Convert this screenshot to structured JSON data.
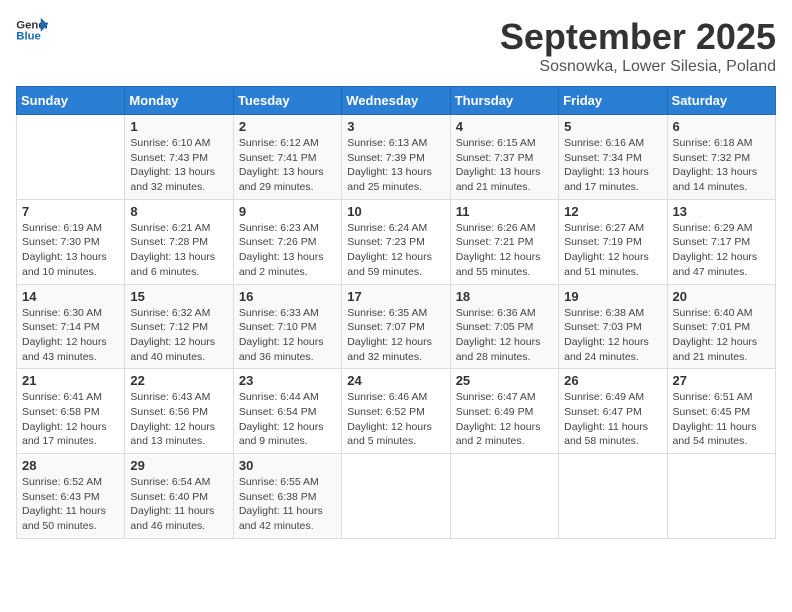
{
  "logo": {
    "text_general": "General",
    "text_blue": "Blue"
  },
  "header": {
    "month": "September 2025",
    "location": "Sosnowka, Lower Silesia, Poland"
  },
  "weekdays": [
    "Sunday",
    "Monday",
    "Tuesday",
    "Wednesday",
    "Thursday",
    "Friday",
    "Saturday"
  ],
  "weeks": [
    [
      {
        "day": "",
        "sunrise": "",
        "sunset": "",
        "daylight": ""
      },
      {
        "day": "1",
        "sunrise": "Sunrise: 6:10 AM",
        "sunset": "Sunset: 7:43 PM",
        "daylight": "Daylight: 13 hours and 32 minutes."
      },
      {
        "day": "2",
        "sunrise": "Sunrise: 6:12 AM",
        "sunset": "Sunset: 7:41 PM",
        "daylight": "Daylight: 13 hours and 29 minutes."
      },
      {
        "day": "3",
        "sunrise": "Sunrise: 6:13 AM",
        "sunset": "Sunset: 7:39 PM",
        "daylight": "Daylight: 13 hours and 25 minutes."
      },
      {
        "day": "4",
        "sunrise": "Sunrise: 6:15 AM",
        "sunset": "Sunset: 7:37 PM",
        "daylight": "Daylight: 13 hours and 21 minutes."
      },
      {
        "day": "5",
        "sunrise": "Sunrise: 6:16 AM",
        "sunset": "Sunset: 7:34 PM",
        "daylight": "Daylight: 13 hours and 17 minutes."
      },
      {
        "day": "6",
        "sunrise": "Sunrise: 6:18 AM",
        "sunset": "Sunset: 7:32 PM",
        "daylight": "Daylight: 13 hours and 14 minutes."
      }
    ],
    [
      {
        "day": "7",
        "sunrise": "Sunrise: 6:19 AM",
        "sunset": "Sunset: 7:30 PM",
        "daylight": "Daylight: 13 hours and 10 minutes."
      },
      {
        "day": "8",
        "sunrise": "Sunrise: 6:21 AM",
        "sunset": "Sunset: 7:28 PM",
        "daylight": "Daylight: 13 hours and 6 minutes."
      },
      {
        "day": "9",
        "sunrise": "Sunrise: 6:23 AM",
        "sunset": "Sunset: 7:26 PM",
        "daylight": "Daylight: 13 hours and 2 minutes."
      },
      {
        "day": "10",
        "sunrise": "Sunrise: 6:24 AM",
        "sunset": "Sunset: 7:23 PM",
        "daylight": "Daylight: 12 hours and 59 minutes."
      },
      {
        "day": "11",
        "sunrise": "Sunrise: 6:26 AM",
        "sunset": "Sunset: 7:21 PM",
        "daylight": "Daylight: 12 hours and 55 minutes."
      },
      {
        "day": "12",
        "sunrise": "Sunrise: 6:27 AM",
        "sunset": "Sunset: 7:19 PM",
        "daylight": "Daylight: 12 hours and 51 minutes."
      },
      {
        "day": "13",
        "sunrise": "Sunrise: 6:29 AM",
        "sunset": "Sunset: 7:17 PM",
        "daylight": "Daylight: 12 hours and 47 minutes."
      }
    ],
    [
      {
        "day": "14",
        "sunrise": "Sunrise: 6:30 AM",
        "sunset": "Sunset: 7:14 PM",
        "daylight": "Daylight: 12 hours and 43 minutes."
      },
      {
        "day": "15",
        "sunrise": "Sunrise: 6:32 AM",
        "sunset": "Sunset: 7:12 PM",
        "daylight": "Daylight: 12 hours and 40 minutes."
      },
      {
        "day": "16",
        "sunrise": "Sunrise: 6:33 AM",
        "sunset": "Sunset: 7:10 PM",
        "daylight": "Daylight: 12 hours and 36 minutes."
      },
      {
        "day": "17",
        "sunrise": "Sunrise: 6:35 AM",
        "sunset": "Sunset: 7:07 PM",
        "daylight": "Daylight: 12 hours and 32 minutes."
      },
      {
        "day": "18",
        "sunrise": "Sunrise: 6:36 AM",
        "sunset": "Sunset: 7:05 PM",
        "daylight": "Daylight: 12 hours and 28 minutes."
      },
      {
        "day": "19",
        "sunrise": "Sunrise: 6:38 AM",
        "sunset": "Sunset: 7:03 PM",
        "daylight": "Daylight: 12 hours and 24 minutes."
      },
      {
        "day": "20",
        "sunrise": "Sunrise: 6:40 AM",
        "sunset": "Sunset: 7:01 PM",
        "daylight": "Daylight: 12 hours and 21 minutes."
      }
    ],
    [
      {
        "day": "21",
        "sunrise": "Sunrise: 6:41 AM",
        "sunset": "Sunset: 6:58 PM",
        "daylight": "Daylight: 12 hours and 17 minutes."
      },
      {
        "day": "22",
        "sunrise": "Sunrise: 6:43 AM",
        "sunset": "Sunset: 6:56 PM",
        "daylight": "Daylight: 12 hours and 13 minutes."
      },
      {
        "day": "23",
        "sunrise": "Sunrise: 6:44 AM",
        "sunset": "Sunset: 6:54 PM",
        "daylight": "Daylight: 12 hours and 9 minutes."
      },
      {
        "day": "24",
        "sunrise": "Sunrise: 6:46 AM",
        "sunset": "Sunset: 6:52 PM",
        "daylight": "Daylight: 12 hours and 5 minutes."
      },
      {
        "day": "25",
        "sunrise": "Sunrise: 6:47 AM",
        "sunset": "Sunset: 6:49 PM",
        "daylight": "Daylight: 12 hours and 2 minutes."
      },
      {
        "day": "26",
        "sunrise": "Sunrise: 6:49 AM",
        "sunset": "Sunset: 6:47 PM",
        "daylight": "Daylight: 11 hours and 58 minutes."
      },
      {
        "day": "27",
        "sunrise": "Sunrise: 6:51 AM",
        "sunset": "Sunset: 6:45 PM",
        "daylight": "Daylight: 11 hours and 54 minutes."
      }
    ],
    [
      {
        "day": "28",
        "sunrise": "Sunrise: 6:52 AM",
        "sunset": "Sunset: 6:43 PM",
        "daylight": "Daylight: 11 hours and 50 minutes."
      },
      {
        "day": "29",
        "sunrise": "Sunrise: 6:54 AM",
        "sunset": "Sunset: 6:40 PM",
        "daylight": "Daylight: 11 hours and 46 minutes."
      },
      {
        "day": "30",
        "sunrise": "Sunrise: 6:55 AM",
        "sunset": "Sunset: 6:38 PM",
        "daylight": "Daylight: 11 hours and 42 minutes."
      },
      {
        "day": "",
        "sunrise": "",
        "sunset": "",
        "daylight": ""
      },
      {
        "day": "",
        "sunrise": "",
        "sunset": "",
        "daylight": ""
      },
      {
        "day": "",
        "sunrise": "",
        "sunset": "",
        "daylight": ""
      },
      {
        "day": "",
        "sunrise": "",
        "sunset": "",
        "daylight": ""
      }
    ]
  ]
}
